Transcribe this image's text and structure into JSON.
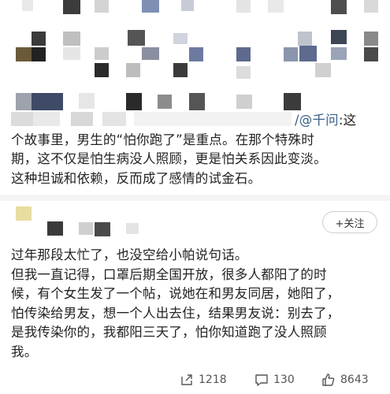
{
  "reply": {
    "mention_prefix": "/@",
    "mention_name": "千问",
    "lines": [
      ":这",
      "个故事里，男生的“怕你跑了”是重点。在那个特殊时",
      "期，这不仅是怕生病没人照顾，更是怕关系因此变淡。",
      "这种坦诚和依赖，反而成了感情的试金石。"
    ]
  },
  "post": {
    "follow_label": "+关注",
    "lines": [
      "过年那段太忙了，也没空给小帕说句话。",
      "但我一直记得，口罩后期全国开放，很多人都阳了的时",
      "候，有个女生发了一个帖，说她在和男友同居，她阳了，",
      "怕传染给男友，想一个人出去住，结果男友说：别去了，",
      "是我传染你的，我都阳三天了，怕你知道跑了没人照顾",
      "我。"
    ],
    "actions": {
      "share_count": "1218",
      "comment_count": "130",
      "like_count": "8643"
    }
  }
}
